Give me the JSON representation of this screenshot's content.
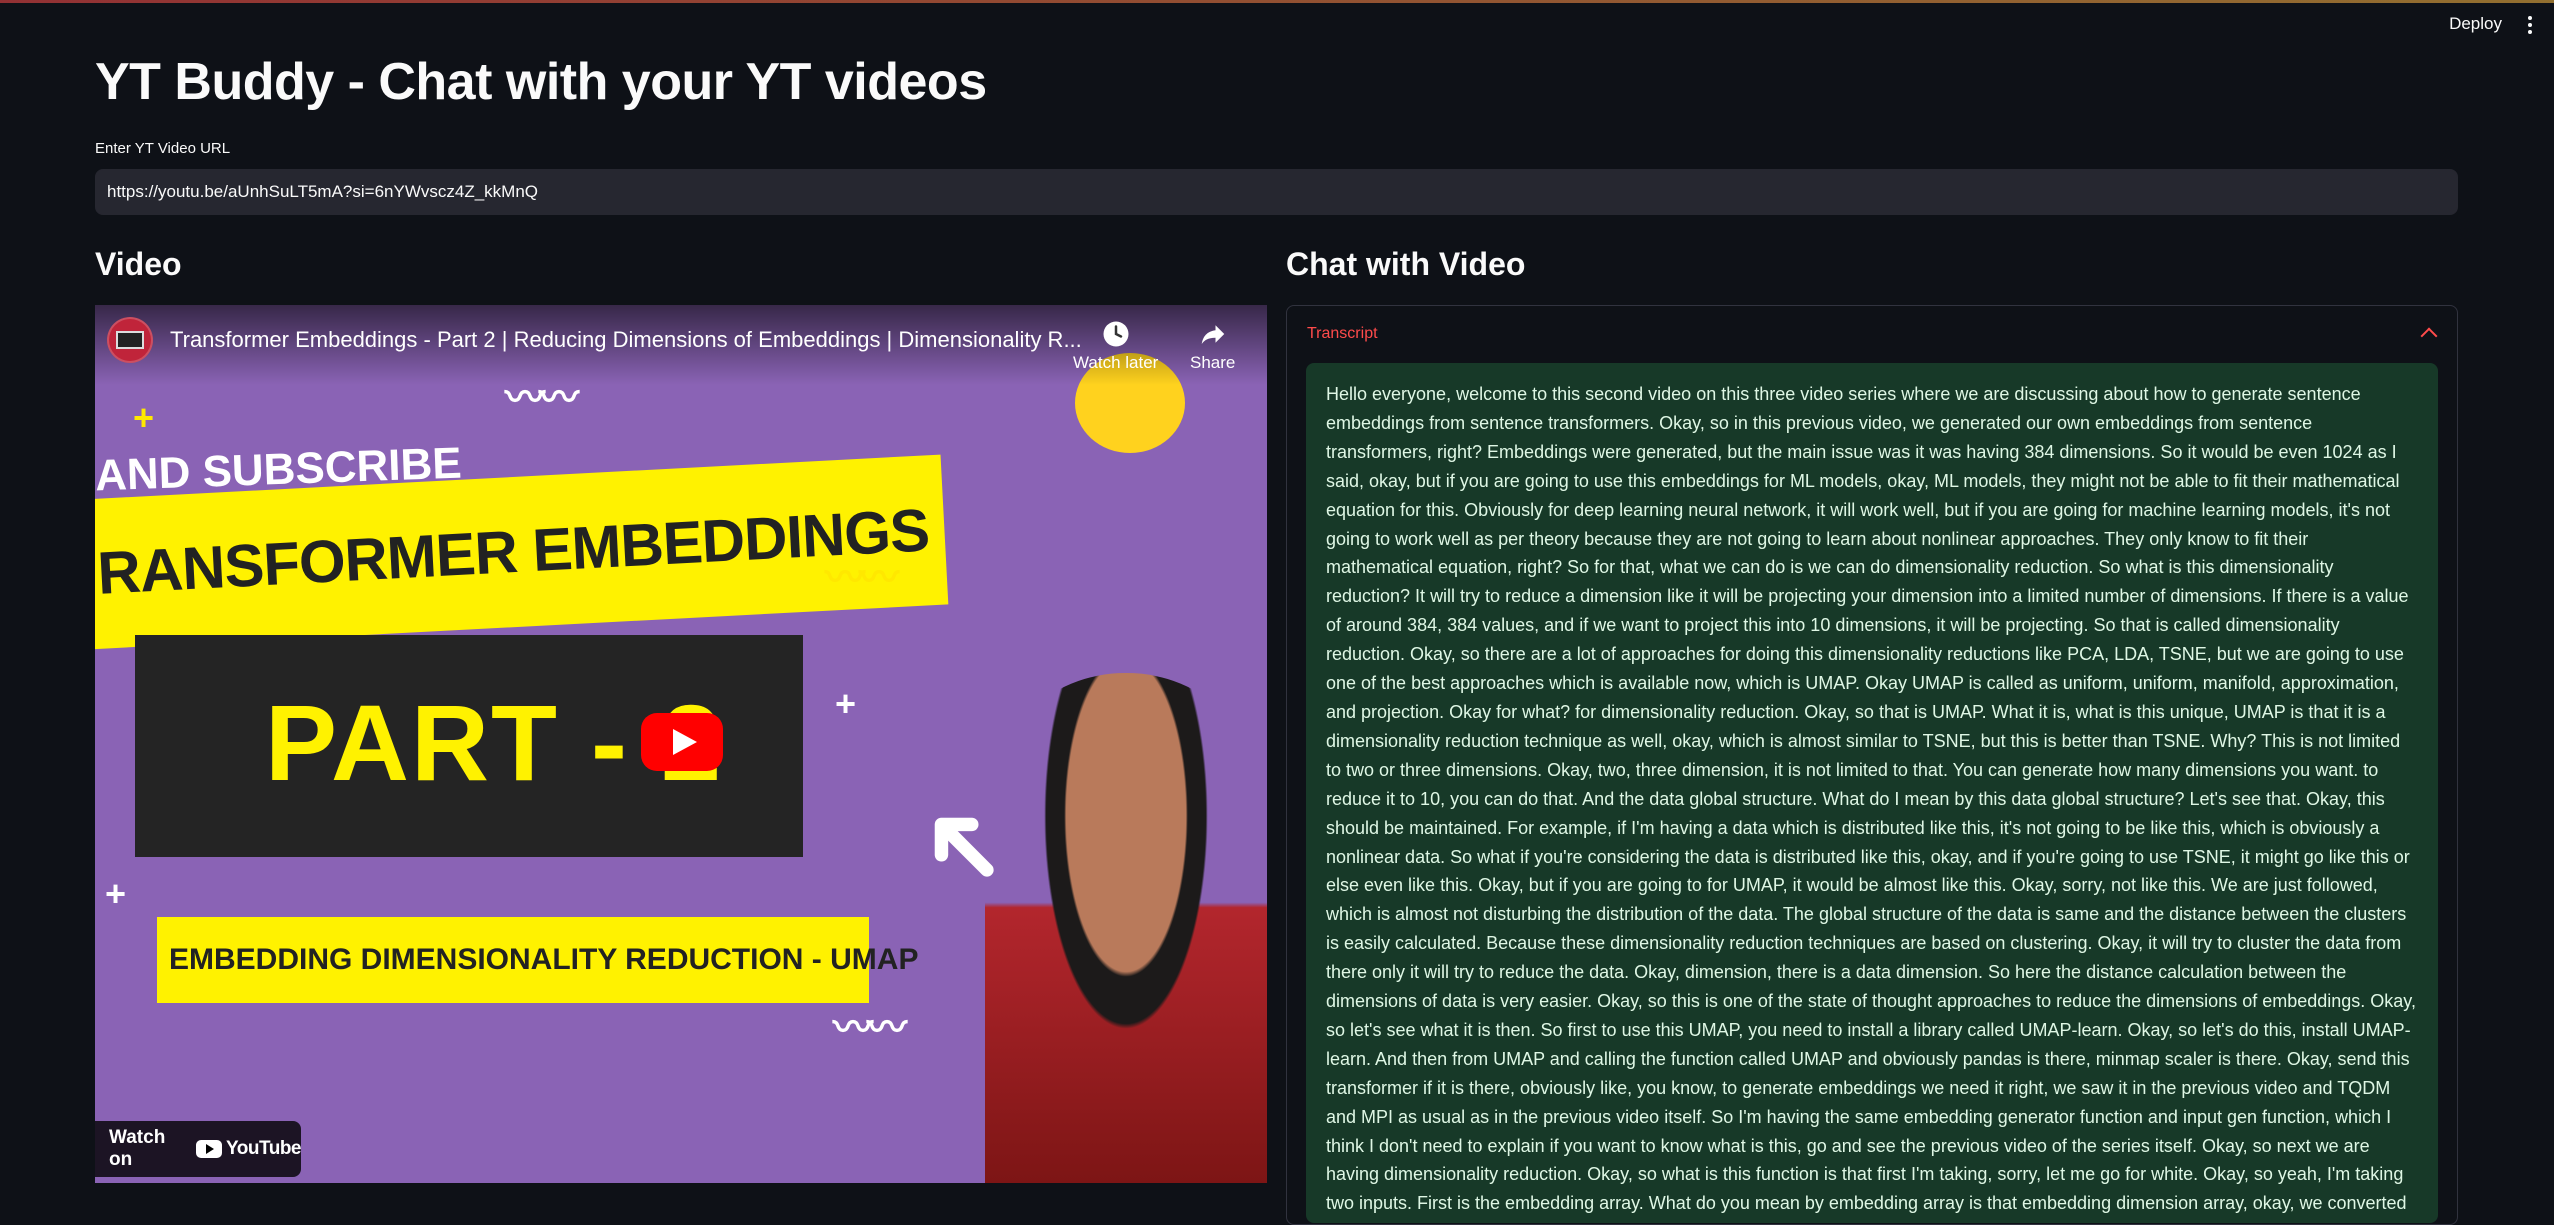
{
  "header": {
    "deploy_label": "Deploy",
    "menu_icon": "kebab-menu-icon"
  },
  "app": {
    "title": "YT Buddy - Chat with your YT videos"
  },
  "url_input": {
    "label": "Enter YT Video URL",
    "value": "https://youtu.be/aUnhSuLT5mA?si=6nYWvscz4Z_kkMnQ"
  },
  "sections": {
    "video_heading": "Video",
    "chat_heading": "Chat with Video"
  },
  "video": {
    "title": "Transformer Embeddings - Part 2 | Reducing Dimensions of Embeddings | Dimensionality R...",
    "watch_later_label": "Watch later",
    "share_label": "Share",
    "watch_on_label": "Watch on",
    "youtube_wordmark": "YouTube",
    "thumbnail": {
      "subscribe_text": "AND SUBSCRIBE",
      "embeddings_text": "RANSFORMER EMBEDDINGS",
      "part_text": "PART - 2",
      "umap_text": "EMBEDDING DIMENSIONALITY REDUCTION - UMAP"
    }
  },
  "transcript": {
    "label": "Transcript",
    "expanded": true,
    "text": "Hello everyone, welcome to this second video on this three video series where we are discussing about how to generate sentence embeddings from sentence transformers. Okay, so in this previous video, we generated our own embeddings from sentence transformers, right? Embeddings were generated, but the main issue was it was having 384 dimensions. So it would be even 1024 as I said, okay, but if you are going to use this embeddings for ML models, okay, ML models, they might not be able to fit their mathematical equation for this. Obviously for deep learning neural network, it will work well, but if you are going for machine learning models, it's not going to work well as per theory because they are not going to learn about nonlinear approaches. They only know to fit their mathematical equation, right? So for that, what we can do is we can do dimensionality reduction. So what is this dimensionality reduction? It will try to reduce a dimension like it will be projecting your dimension into a limited number of dimensions. If there is a value of around 384, 384 values, and if we want to project this into 10 dimensions, it will be projecting. So that is called dimensionality reduction. Okay, so there are a lot of approaches for doing this dimensionality reductions like PCA, LDA, TSNE, but we are going to use one of the best approaches which is available now, which is UMAP. Okay UMAP is called as uniform, uniform, manifold, approximation, and projection. Okay for what? for dimensionality reduction. Okay, so that is UMAP. What it is, what is this unique, UMAP is that it is a dimensionality reduction technique as well, okay, which is almost similar to TSNE, but this is better than TSNE. Why? This is not limited to two or three dimensions. Okay, two, three dimension, it is not limited to that. You can generate how many dimensions you want. to reduce it to 10, you can do that. And the data global structure. What do I mean by this data global structure? Let's see that. Okay, this should be maintained. For example, if I'm having a data which is distributed like this, it's not going to be like this, which is obviously a nonlinear data. So what if you're considering the data is distributed like this, okay, and if you're going to use TSNE, it might go like this or else even like this. Okay, but if you are going to for UMAP, it would be almost like this. Okay, sorry, not like this. We are just followed, which is almost not disturbing the distribution of the data. The global structure of the data is same and the distance between the clusters is easily calculated. Because these dimensionality reduction techniques are based on clustering. Okay, it will try to cluster the data from there only it will try to reduce the data. Okay, dimension, there is a data dimension. So here the distance calculation between the dimensions of data is very easier. Okay, so this is one of the state of thought approaches to reduce the dimensions of embeddings. Okay, so let's see what it is then. So first to use this UMAP, you need to install a library called UMAP-learn. Okay, so let's do this, install UMAP-learn. And then from UMAP and calling the function called UMAP and obviously pandas is there, minmap scaler is there. Okay, send this transformer if it is there, obviously like, you know, to generate embeddings we need it right, we saw it in the previous video and TQDM and MPI as usual as in the previous video itself. So I'm having the same embedding generator function and input gen function, which I think I don't need to explain if you want to know what is this, go and see the previous video of the series itself. Okay, so next we are having dimensionality reduction. Okay, so what is this function is that first I'm taking, sorry, let me go for white. Okay, so yeah, I'm taking two inputs. First is the embedding array. What do you mean by embedding array is that embedding dimension array, okay, we converted"
  }
}
